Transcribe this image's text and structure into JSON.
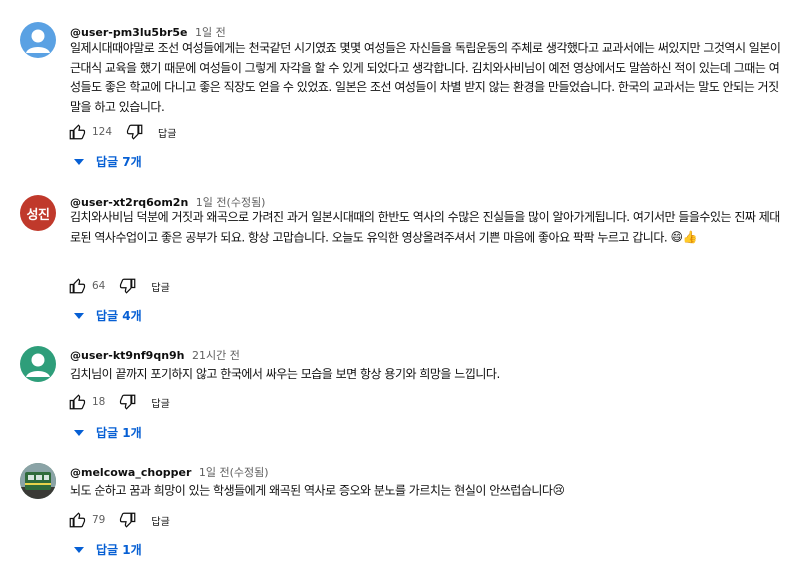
{
  "comments": [
    {
      "author": "@user-pm3lu5br5e",
      "time": "1일 전",
      "text": "일제시대때야말로 조선 여성들에게는 천국같던 시기였죠 몇몇 여성들은 자신들을 독립운동의 주체로 생각했다고 교과서에는 써있지만 그것역시 일본이 근대식 교육을 했기 때문에 여성들이 그렇게 자각을 할 수 있게 되었다고 생각합니다. 김치와사비님이 예전 영상에서도 말씀하신 적이 있는데 그때는 여성들도 좋은 학교에 다니고 좋은 직장도 얻을 수 있었죠. 일본은 조선 여성들이 차별 받지 않는 환경을 만들었습니다. 한국의 교과서는 말도 안되는 거짓말을 하고 있습니다.",
      "likes": "124",
      "reply_label": "답글",
      "replies_label": "답글 7개",
      "avatar_icon": "default-user-icon",
      "avatar_color": "#5aa1e3"
    },
    {
      "author": "@user-xt2rq6om2n",
      "time": "1일 전(수정됨)",
      "text": "김치와사비님 덕분에 거짓과 왜곡으로 가려진 과거 일본시대때의 한반도 역사의 수많은 진실들을 많이 알아가게됩니다. 여기서만 들을수있는 진짜 제대로된 역사수업이고 좋은 공부가 되요. 항상 고맙습니다. 오늘도 유익한 영상올려주셔서 기쁜 마음에 좋아요 팍팍 누르고 갑니다.",
      "emoji": "😄👍",
      "likes": "64",
      "reply_label": "답글",
      "replies_label": "답글 4개",
      "avatar_text": "성진",
      "avatar_color": "#c0392b"
    },
    {
      "author": "@user-kt9nf9qn9h",
      "time": "21시간 전",
      "text": "김치님이 끝까지 포기하지 않고 한국에서 싸우는 모습을 보면 항상 용기와 희망을 느낍니다.",
      "likes": "18",
      "reply_label": "답글",
      "replies_label": "답글 1개",
      "avatar_icon": "default-user-icon",
      "avatar_color": "#2e9e7a"
    },
    {
      "author": "@melcowa_chopper",
      "time": "1일 전(수정됨)",
      "text": "뇌도 순하고 꿈과 희망이 있는 학생들에게 왜곡된 역사로 증오와 분노를 가르치는 현실이 안쓰럽습니다",
      "emoji": "😢",
      "likes": "79",
      "reply_label": "답글",
      "replies_label": "답글 1개",
      "avatar_icon": "train-photo-icon",
      "avatar_color": "#3d6b45"
    }
  ]
}
